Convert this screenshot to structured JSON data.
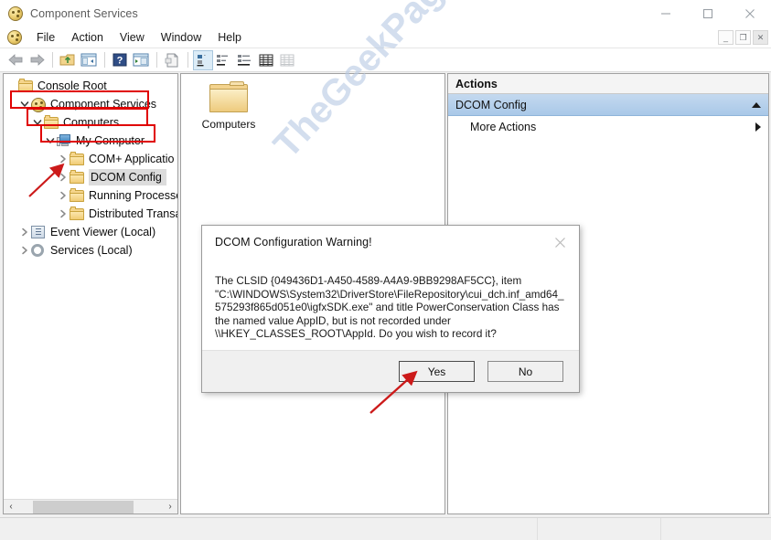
{
  "window": {
    "title": "Component Services",
    "app_icon": "component-services-icon",
    "controls": {
      "minimize": "—",
      "maximize": "□",
      "close": "✕"
    }
  },
  "menubar": {
    "items": [
      "File",
      "Action",
      "View",
      "Window",
      "Help"
    ],
    "mdi_controls": {
      "minimize": "_",
      "restore": "❐",
      "close": "✕"
    }
  },
  "toolbar": {
    "buttons": [
      "back-icon",
      "forward-icon",
      "up-folder-icon",
      "show-tree-icon",
      "properties-icon",
      "help-icon",
      "refresh-icon",
      "export-list-icon",
      "large-icons-icon",
      "small-icons-icon",
      "list-view-icon",
      "detail-view-icon"
    ]
  },
  "tree": {
    "items": [
      {
        "label": "Console Root",
        "icon": "folder-icon",
        "indent": 0,
        "expander": "none",
        "selected": false
      },
      {
        "label": "Component Services",
        "icon": "component-services-icon",
        "indent": 1,
        "expander": "open",
        "selected": false
      },
      {
        "label": "Computers",
        "icon": "folder-icon",
        "indent": 2,
        "expander": "open",
        "selected": false
      },
      {
        "label": "My Computer",
        "icon": "computer-icon",
        "indent": 3,
        "expander": "open",
        "selected": false
      },
      {
        "label": "COM+ Applicatio",
        "icon": "folder-icon",
        "indent": 4,
        "expander": "closed",
        "selected": false
      },
      {
        "label": "DCOM Config",
        "icon": "folder-icon",
        "indent": 4,
        "expander": "closed",
        "selected": true
      },
      {
        "label": "Running Processe",
        "icon": "folder-icon",
        "indent": 4,
        "expander": "closed",
        "selected": false
      },
      {
        "label": "Distributed Transa",
        "icon": "folder-icon",
        "indent": 4,
        "expander": "closed",
        "selected": false
      },
      {
        "label": "Event Viewer (Local)",
        "icon": "event-viewer-icon",
        "indent": 1,
        "expander": "closed",
        "selected": false
      },
      {
        "label": "Services (Local)",
        "icon": "services-gear-icon",
        "indent": 1,
        "expander": "closed",
        "selected": false
      }
    ],
    "scrollbar": {
      "left_arrow": "‹",
      "right_arrow": "›"
    }
  },
  "list_panel": {
    "items": [
      {
        "label": "Computers",
        "icon": "folder-icon"
      }
    ]
  },
  "actions": {
    "header": "Actions",
    "group": {
      "label": "DCOM Config",
      "collapse_icon": "chevron-up-icon"
    },
    "rows": [
      {
        "label": "More Actions",
        "submenu_icon": "chevron-right-icon"
      }
    ]
  },
  "dialog": {
    "title": "DCOM Configuration Warning!",
    "close_icon": "close-icon",
    "message": "The CLSID {049436D1-A450-4589-A4A9-9BB9298AF5CC}, item\n\"C:\\WINDOWS\\System32\\DriverStore\\FileRepository\\cui_dch.inf_amd64_\n575293f865d051e0\\igfxSDK.exe\" and title PowerConservation Class has\nthe named value AppID, but is not recorded under\n\\\\HKEY_CLASSES_ROOT\\AppId.  Do you wish to record it?",
    "buttons": {
      "yes": "Yes",
      "no": "No"
    }
  },
  "watermark": {
    "text": "TheGeekPage.com",
    "copyright": "©",
    "color": "#b9cbe4"
  },
  "annotations": {
    "box_color": "#e00000",
    "arrow_color": "#cc1a1a",
    "boxes": [
      "component-services-row",
      "computers-row",
      "my-computer-row"
    ],
    "arrows": [
      "arrow-to-dcom-config",
      "arrow-to-yes-button"
    ]
  }
}
